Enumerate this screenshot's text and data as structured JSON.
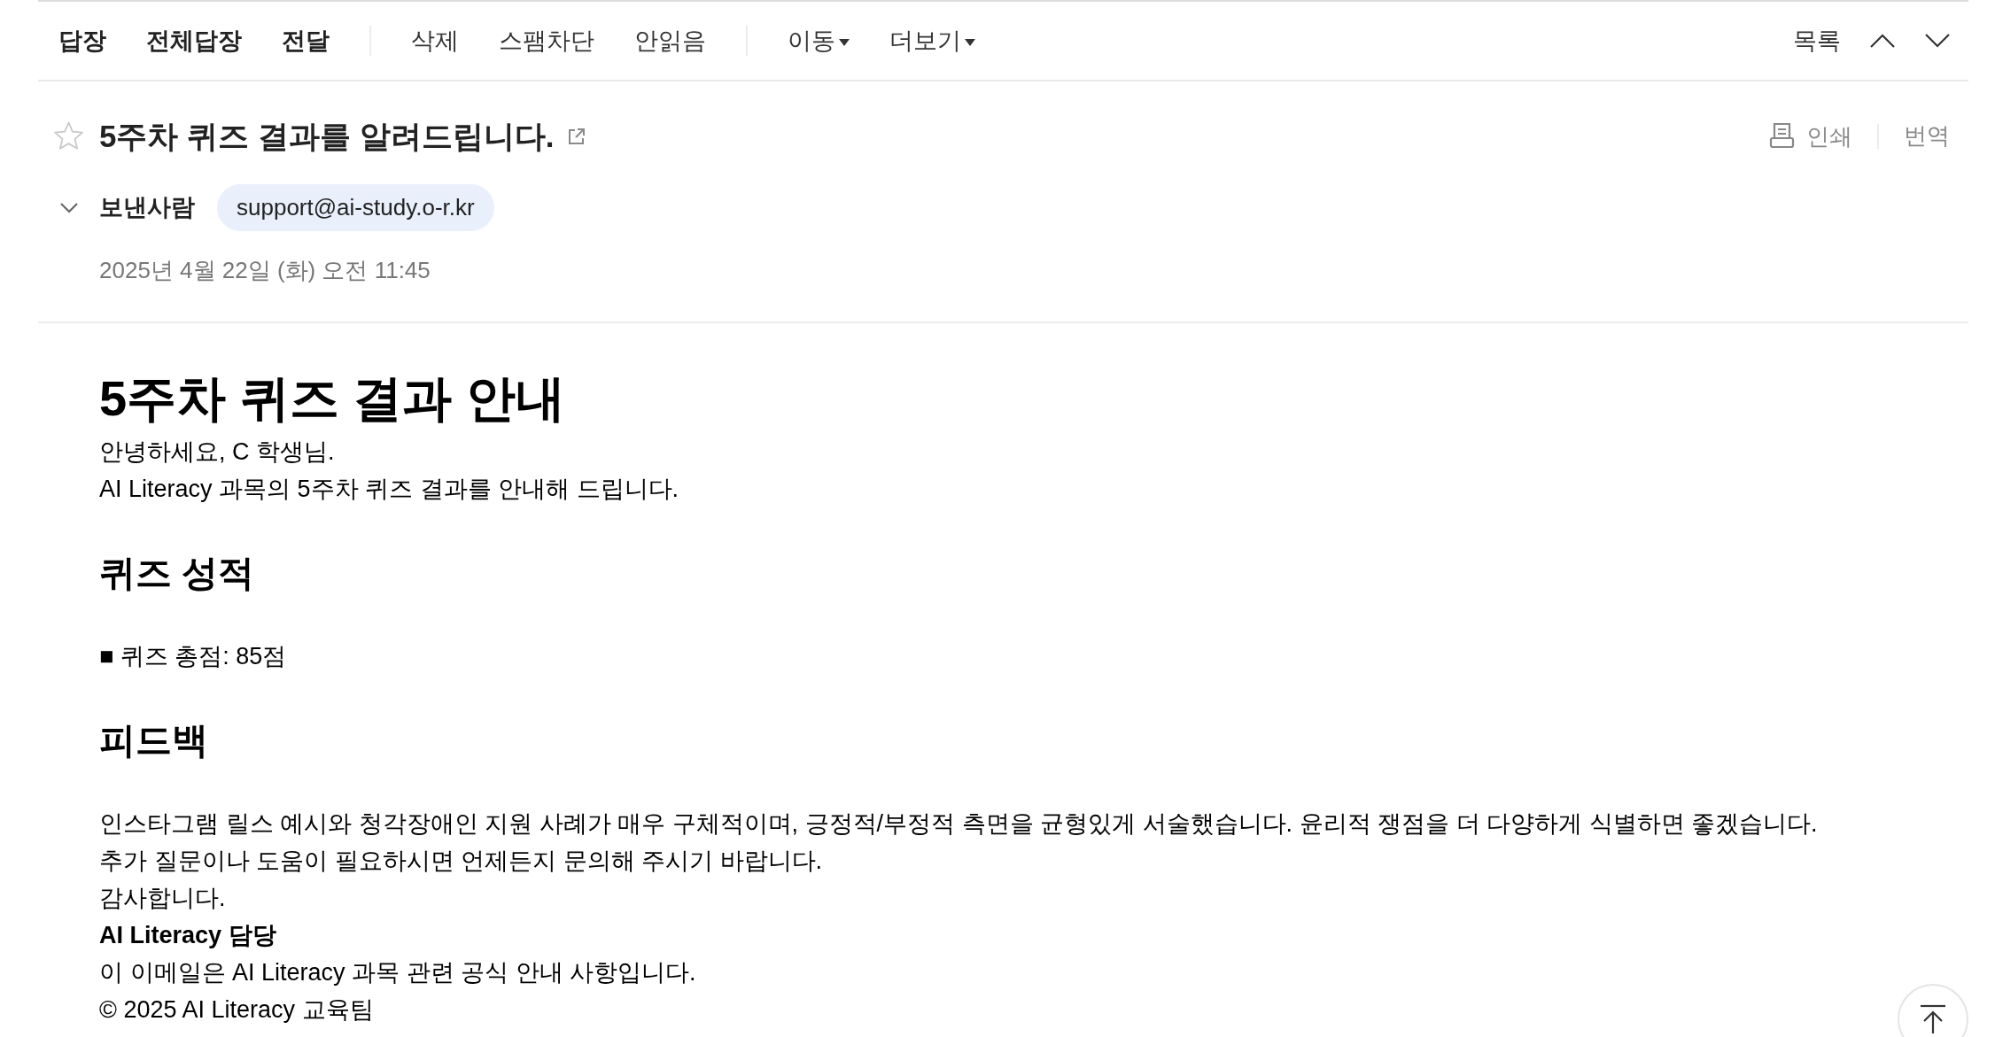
{
  "toolbar": {
    "groups": [
      {
        "kind": "primary",
        "items": [
          "답장",
          "전체답장",
          "전달"
        ]
      },
      {
        "kind": "secondary",
        "items": [
          "삭제",
          "스팸차단",
          "안읽음"
        ]
      },
      {
        "kind": "menu",
        "items": [
          "이동",
          "더보기"
        ]
      }
    ],
    "list_button": "목록"
  },
  "message": {
    "starred": false,
    "subject": "5주차 퀴즈 결과를 알려드립니다.",
    "tools": [
      {
        "kind": "print",
        "label": "인쇄"
      },
      {
        "kind": "translate",
        "label": "번역"
      }
    ],
    "sender": {
      "label": "보낸사람",
      "expanded": false,
      "address": "support@ai-study.o-r.kr"
    },
    "date": "2025년 4월 22일 (화) 오전 11:45"
  },
  "body": {
    "title": "5주차 퀴즈 결과 안내",
    "blocks": [
      {
        "kind": "line",
        "text": "안녕하세요, C 학생님."
      },
      {
        "kind": "line",
        "text": "AI Literacy 과목의 5주차 퀴즈 결과를 안내해 드립니다."
      },
      {
        "kind": "heading",
        "text": "퀴즈 성적"
      },
      {
        "kind": "line",
        "text": "■ 퀴즈 총점: 85점"
      },
      {
        "kind": "heading",
        "text": "피드백"
      },
      {
        "kind": "line",
        "text": "인스타그램 릴스 예시와 청각장애인 지원 사례가 매우 구체적이며, 긍정적/부정적 측면을 균형있게 서술했습니다. 윤리적 쟁점을 더 다양하게 식별하면 좋겠습니다."
      },
      {
        "kind": "line",
        "text": "추가 질문이나 도움이 필요하시면 언제든지 문의해 주시기 바랍니다."
      },
      {
        "kind": "line",
        "text": "감사합니다."
      },
      {
        "kind": "strong_line",
        "text": "AI Literacy 담당"
      },
      {
        "kind": "line",
        "text": "이 이메일은 AI Literacy 과목 관련 공식 안내 사항입니다."
      },
      {
        "kind": "line",
        "text": "© 2025 AI Literacy 교육팀"
      }
    ]
  }
}
